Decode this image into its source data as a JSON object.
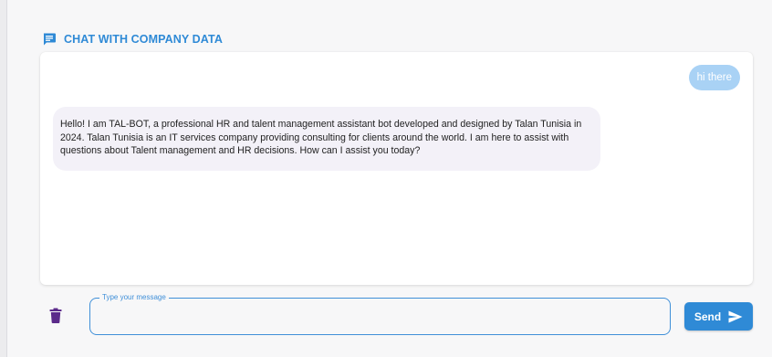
{
  "colors": {
    "accent": "#2f8ad6",
    "user_bubble": "#a9d2f5",
    "bot_bubble": "#f3f1f8",
    "trash": "#5b2a8a"
  },
  "header": {
    "icon": "chat-bubble-icon",
    "title": "CHAT WITH COMPANY DATA"
  },
  "chat": {
    "messages": [
      {
        "role": "user",
        "text": "hi there"
      },
      {
        "role": "bot",
        "text": "Hello! I am TAL-BOT, a professional HR and talent management assistant bot developed and designed by Talan Tunisia in 2024. Talan Tunisia is an IT services company providing consulting for clients around the world. I am here to assist with questions about Talent management and HR decisions. How can I assist you today?"
      }
    ]
  },
  "composer": {
    "trash_icon": "trash-icon",
    "input_label": "Type your message",
    "input_value": "",
    "send_label": "Send",
    "send_icon": "send-arrow-icon"
  }
}
